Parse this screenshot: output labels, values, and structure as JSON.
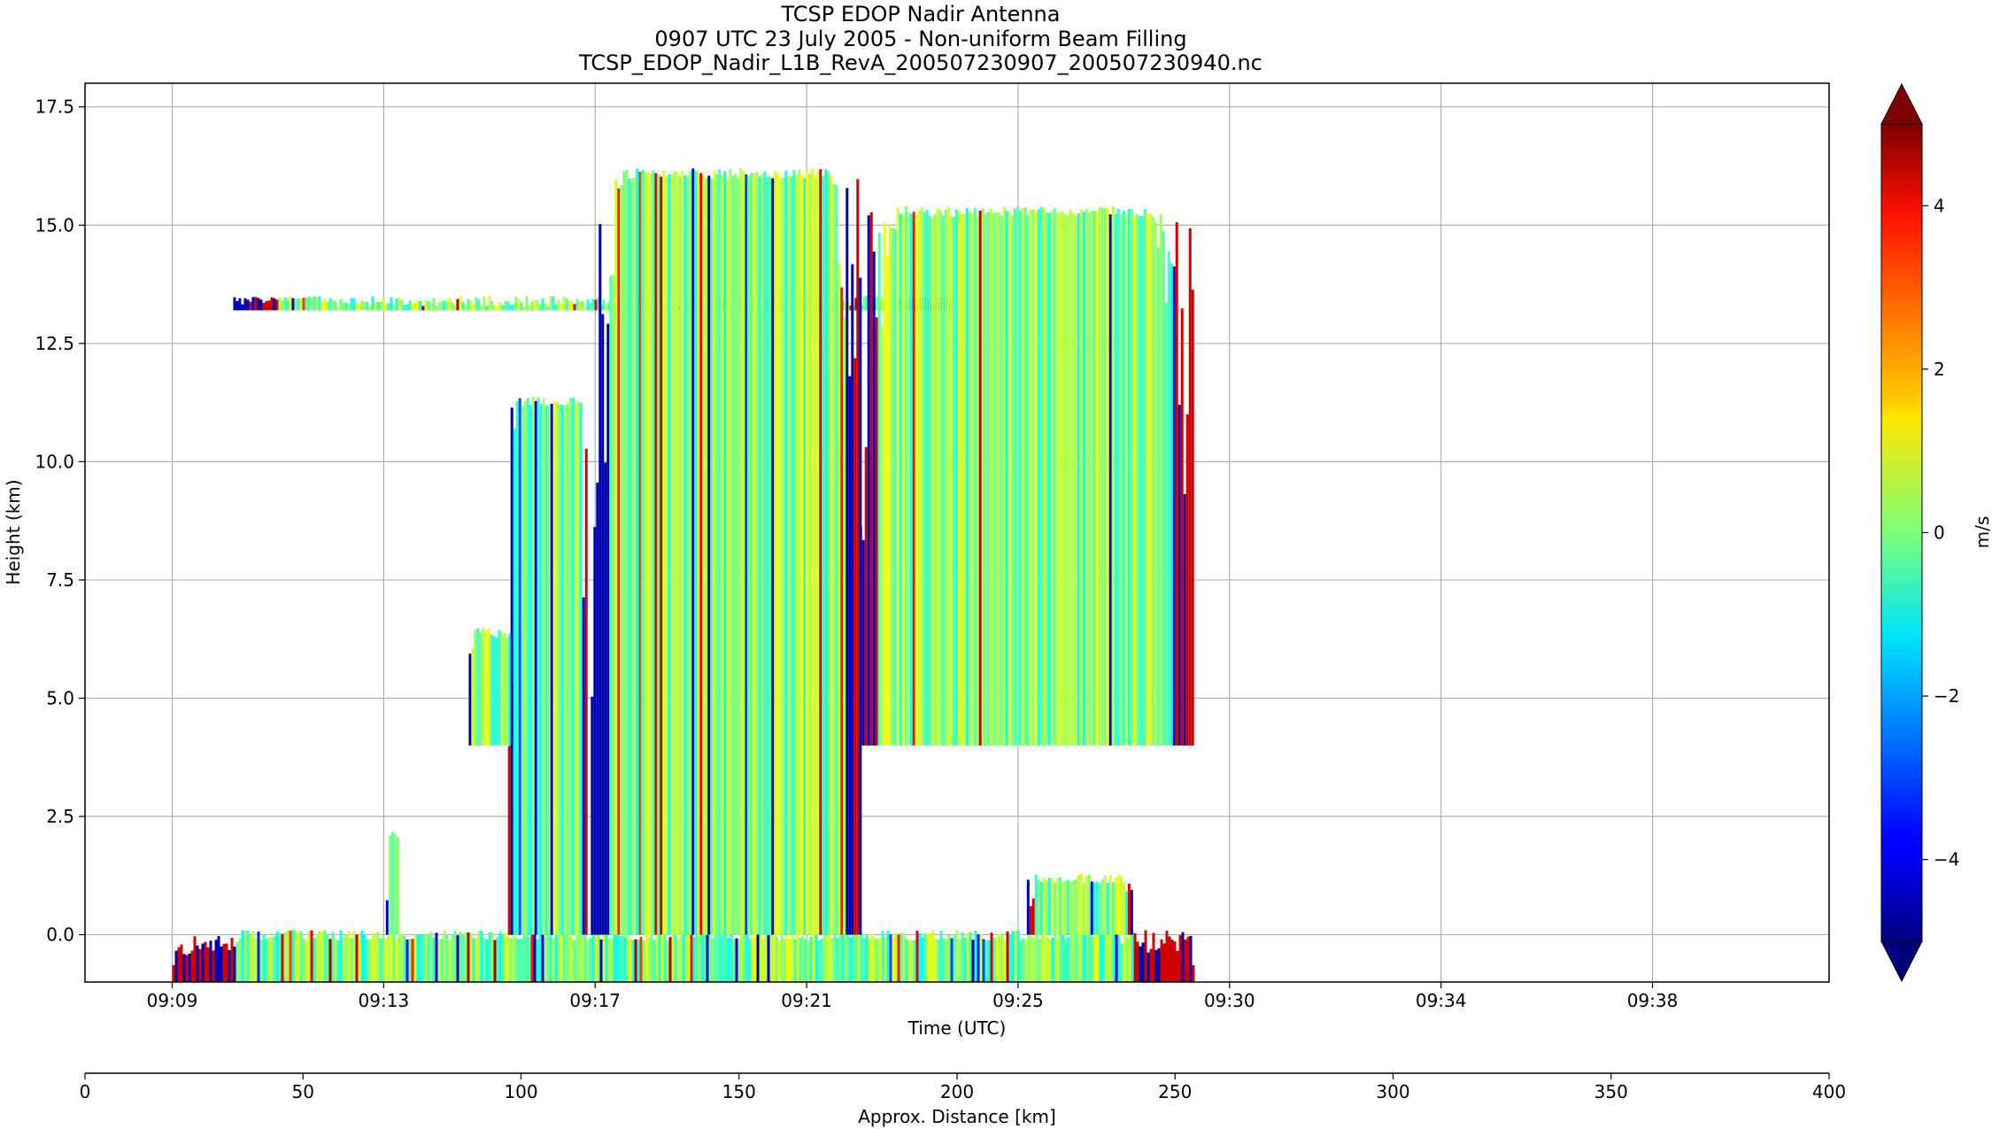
{
  "title_lines": [
    "TCSP EDOP Nadir Antenna",
    "0907 UTC 23 July 2005 - Non-uniform Beam Filling",
    "TCSP_EDOP_Nadir_L1B_RevA_200507230907_200507230940.nc"
  ],
  "chart_data": {
    "type": "heatmap",
    "xlabel": "Time (UTC)",
    "ylabel": "Height (km)",
    "secondary_xlabel": "Approx. Distance [km]",
    "colorbar_label": "m/s",
    "x_ticks": [
      "09:09",
      "09:13",
      "09:17",
      "09:21",
      "09:25",
      "09:30",
      "09:34",
      "09:38"
    ],
    "x_tick_positions_km": [
      20,
      68.5,
      117,
      165.5,
      214,
      262.5,
      311,
      359.5
    ],
    "y_ticks": [
      0.0,
      2.5,
      5.0,
      7.5,
      10.0,
      12.5,
      15.0,
      17.5
    ],
    "ylim": [
      -1.0,
      18.0
    ],
    "secondary_x_ticks": [
      0,
      50,
      100,
      150,
      200,
      250,
      300,
      350,
      400
    ],
    "secondary_xlim": [
      0,
      400
    ],
    "colorbar_ticks": [
      4,
      2,
      0,
      -2,
      -4
    ],
    "colorbar_range": [
      -5,
      5
    ],
    "colormap": "jet",
    "colorbar_extend": "both",
    "grid": true,
    "features": [
      {
        "name": "surface/ground return",
        "x_km": [
          20,
          254
        ],
        "height_km": [
          -1.0,
          0.1
        ]
      },
      {
        "name": "thin cirrus layer",
        "x_km": [
          34,
          198
        ],
        "height_km": [
          13.2,
          13.5
        ]
      },
      {
        "name": "low echo",
        "x_km": [
          69,
          72
        ],
        "height_km": [
          0,
          2.2
        ]
      },
      {
        "name": "small convective cell",
        "x_km": [
          88,
          98
        ],
        "height_km": [
          4,
          6.5
        ]
      },
      {
        "name": "convective tower",
        "x_km": [
          97,
          115
        ],
        "height_km": [
          0,
          11.4
        ]
      },
      {
        "name": "convective tower",
        "x_km": [
          116,
          178
        ],
        "height_km": [
          0,
          16.2
        ]
      },
      {
        "name": "deep stratiform/anvil region",
        "x_km": [
          177,
          254
        ],
        "height_km": [
          4,
          15.4
        ]
      },
      {
        "name": "low-level echo",
        "x_km": [
          216,
          240
        ],
        "height_km": [
          0,
          1.3
        ]
      }
    ]
  }
}
